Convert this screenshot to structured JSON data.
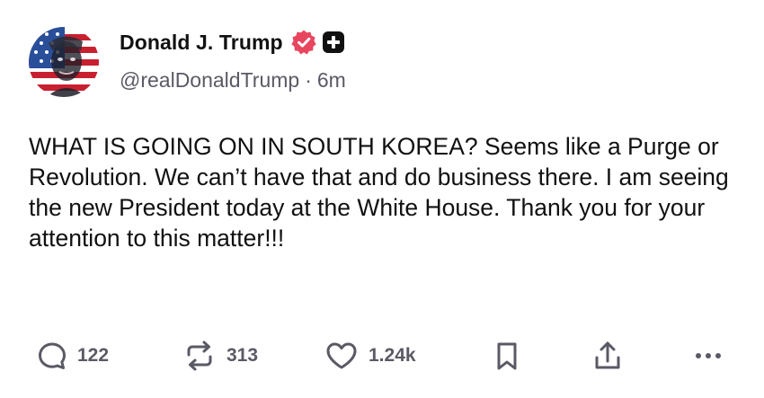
{
  "author": {
    "display_name": "Donald J. Trump",
    "handle": "@realDonaldTrump",
    "time_separator": "·",
    "time_ago": "6m",
    "verified_color": "#e8455f"
  },
  "post": {
    "text": "WHAT IS GOING ON IN SOUTH KOREA? Seems like a Purge or Revolution. We can’t have that and do business there. I am seeing the new President today at the White House. Thank you for your attention to this matter!!!"
  },
  "actions": {
    "reply": {
      "icon": "reply-icon",
      "count": "122"
    },
    "retruth": {
      "icon": "retruth-icon",
      "count": "313"
    },
    "like": {
      "icon": "heart-icon",
      "count": "1.24k"
    },
    "bookmark": {
      "icon": "bookmark-icon"
    },
    "share": {
      "icon": "share-icon"
    },
    "more": {
      "icon": "more-icon"
    }
  }
}
